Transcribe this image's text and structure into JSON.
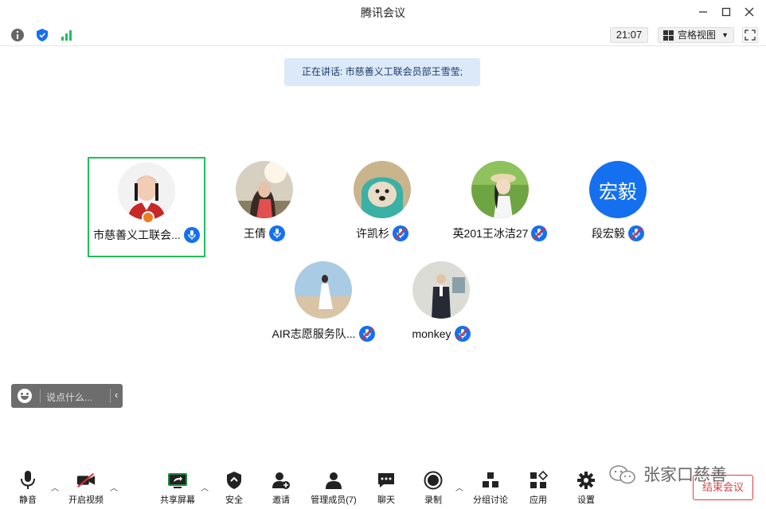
{
  "window": {
    "title": "腾讯会议"
  },
  "toolbar": {
    "time": "21:07",
    "view_label": "宫格视图"
  },
  "speaking": {
    "text": "正在讲话: 市慈善义工联会员部王雪莹;"
  },
  "participants": [
    {
      "name": "市慈善义工联会...",
      "mic": "active",
      "host": true
    },
    {
      "name": "王倩",
      "mic": "active"
    },
    {
      "name": "许凯杉",
      "mic": "muted"
    },
    {
      "name": "英201王冰洁27",
      "mic": "muted"
    },
    {
      "name": "段宏毅",
      "mic": "muted",
      "avatar_text": "宏毅"
    },
    {
      "name": "AIR志愿服务队...",
      "mic": "muted"
    },
    {
      "name": "monkey",
      "mic": "muted"
    }
  ],
  "chat": {
    "placeholder": "说点什么..."
  },
  "bottom": {
    "mute": "静音",
    "video": "开启视频",
    "share": "共享屏幕",
    "security": "安全",
    "invite": "邀请",
    "members": "管理成员(7)",
    "chat": "聊天",
    "record": "录制",
    "breakout": "分组讨论",
    "apps": "应用",
    "settings": "设置",
    "end": "结束会议"
  },
  "watermark": {
    "text": "张家口慈善"
  },
  "colors": {
    "accent_blue": "#1570ef",
    "active_border": "#1fbf5c",
    "end_red": "#e04040",
    "banner_bg": "#dce9f9"
  }
}
